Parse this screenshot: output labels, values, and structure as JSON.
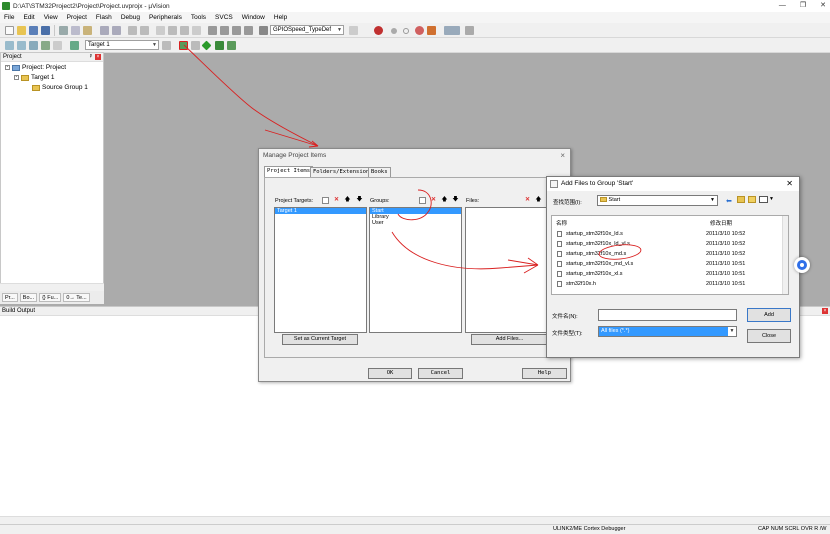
{
  "window": {
    "title": "D:\\AT\\STM32Project2\\Project\\Project.uvprojx - µVision",
    "controls": [
      "—",
      "❐",
      "✕"
    ]
  },
  "menu": [
    "File",
    "Edit",
    "View",
    "Project",
    "Flash",
    "Debug",
    "Peripherals",
    "Tools",
    "SVCS",
    "Window",
    "Help"
  ],
  "toolbar": {
    "find_combo": "GPIOSpeed_TypeDef",
    "target_combo": "Target 1"
  },
  "project_panel": {
    "header": "Project",
    "tree": [
      "Project: Project",
      "Target 1",
      "Source Group 1"
    ],
    "tabs": [
      "Pr...",
      "Bo...",
      "{} Fu...",
      "0→ Te..."
    ]
  },
  "build_output": {
    "header": "Build Output"
  },
  "status": {
    "debugger": "ULINK2/ME Cortex Debugger",
    "indicators": "CAP  NUM  SCRL  OVR  R /W"
  },
  "manage_dialog": {
    "title": "Manage Project Items",
    "tabs": [
      "Project Items",
      "Folders/Extensions",
      "Books"
    ],
    "targets_label": "Project Targets:",
    "targets": [
      "Target 1"
    ],
    "groups_label": "Groups:",
    "groups": [
      "Start",
      "Library",
      "User"
    ],
    "files_label": "Files:",
    "set_current_target": "Set as Current Target",
    "add_files": "Add Files...",
    "ok": "OK",
    "cancel": "Cancel",
    "help": "Help"
  },
  "add_dialog": {
    "title": "Add Files to Group 'Start'",
    "look_in_label": "查找范围(I):",
    "look_in_value": "Start",
    "col_name": "名称",
    "col_date": "修改日期",
    "files": [
      {
        "name": "startup_stm32f10x_ld.s",
        "date": "2011/3/10 10:52"
      },
      {
        "name": "startup_stm32f10x_ld_vl.s",
        "date": "2011/3/10 10:52"
      },
      {
        "name": "startup_stm32f10x_md.s",
        "date": "2011/3/10 10:52"
      },
      {
        "name": "startup_stm32f10x_md_vl.s",
        "date": "2011/3/10 10:51"
      },
      {
        "name": "startup_stm32f10x_xl.s",
        "date": "2011/3/10 10:51"
      },
      {
        "name": "stm32f10x.h",
        "date": "2011/3/10 10:51"
      }
    ],
    "filename_label": "文件名(N):",
    "filetype_label": "文件类型(T):",
    "filetype_value": "All files (*.*)",
    "add_btn": "Add",
    "close_btn": "Close"
  },
  "colors": {
    "selection": "#3399ff",
    "annotation": "#d92020",
    "accent_green": "#2e8b2e"
  }
}
